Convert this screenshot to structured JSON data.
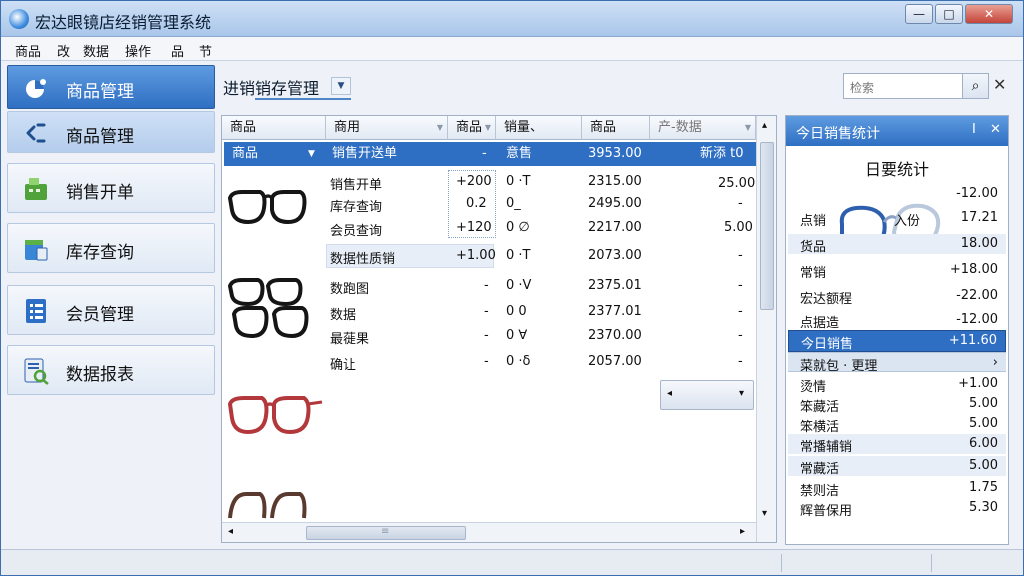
{
  "window": {
    "title": "宏达眼镜店经销管理系统",
    "controls": {
      "minimize": "—",
      "maximize": "□",
      "close": "✕"
    }
  },
  "menubar": {
    "items": [
      "商品",
      "改",
      "数据",
      "操作",
      "品",
      "节"
    ]
  },
  "sidebar": {
    "items": [
      {
        "label": "商品管理",
        "icon": "pie-chart-icon",
        "state": "active"
      },
      {
        "label": "商品管理",
        "icon": "link-icon",
        "state": "highlight"
      },
      {
        "label": "销售开单",
        "icon": "cash-register-icon",
        "state": "normal"
      },
      {
        "label": "库存查询",
        "icon": "inventory-icon",
        "state": "normal"
      },
      {
        "label": "会员管理",
        "icon": "list-icon",
        "state": "normal"
      },
      {
        "label": "数据报表",
        "icon": "report-search-icon",
        "state": "normal"
      }
    ]
  },
  "main": {
    "title": "进销销存管理",
    "title_dropdown": "▼",
    "search": {
      "placeholder": "检索",
      "button": "⌕"
    },
    "close": "✕"
  },
  "grid": {
    "headers": [
      "商品",
      "商用",
      "商品",
      "销量、",
      "商品",
      "产-数据"
    ],
    "selected_row": [
      "商品",
      "销售开送单",
      "-",
      "意售",
      "3953.00",
      "新添 t0"
    ],
    "rows": [
      {
        "name": "销售开单",
        "c2": "+200",
        "c3": "0 ·T",
        "c4": "2315.00",
        "c5": "25.00"
      },
      {
        "name": "库存查询",
        "c2": "0.2",
        "c3": "0_",
        "c4": "2495.00",
        "c5": "-"
      },
      {
        "name": "会员查询",
        "c2": "+120",
        "c3": "0 ∅",
        "c4": "2217.00",
        "c5": "5.00"
      },
      {
        "name": "数据性质销",
        "c2": "+1.00",
        "c3": "0 ·T",
        "c4": "2073.00",
        "c5": "-"
      },
      {
        "name": "数跑图",
        "c2": "-",
        "c3": "0 ·V",
        "c4": "2375.01",
        "c5": "-"
      },
      {
        "name": "数据",
        "c2": "-",
        "c3": "0 0",
        "c4": "2377.01",
        "c5": "-"
      },
      {
        "name": "最蓰果",
        "c2": "-",
        "c3": "0 ∀",
        "c4": "2370.00",
        "c5": "-"
      },
      {
        "name": "确让",
        "c2": "-",
        "c3": "0 ·δ",
        "c4": "2057.00",
        "c5": "-"
      }
    ],
    "nav_left": "◂",
    "nav_right": "▾",
    "hscroll_mark": "≡",
    "scroll_left": "◂",
    "scroll_right": "▸",
    "scroll_up": "▴",
    "scroll_down": "▾"
  },
  "right_panel": {
    "title": "今日销售统计",
    "pin": "I",
    "close": "✕",
    "subtitle": "日要统计",
    "rows": [
      {
        "label": "",
        "value": "-12.00",
        "style": "normal"
      },
      {
        "label": "点销",
        "value": "17.21",
        "style": "normal",
        "mid": "入份"
      },
      {
        "label": "货品",
        "value": "18.00",
        "style": "shade"
      },
      {
        "label": "常销",
        "value": "+18.00",
        "style": "normal"
      },
      {
        "label": "宏达额程",
        "value": "-22.00",
        "style": "normal"
      },
      {
        "label": "点据造",
        "value": "-12.00",
        "style": "normal"
      },
      {
        "label": "今日销售",
        "value": "+11.60",
        "style": "sel"
      },
      {
        "label": "菜就包 · 更理",
        "value": "›",
        "style": "tool"
      },
      {
        "label": "烫情",
        "value": "+1.00",
        "style": "normal"
      },
      {
        "label": "笨藏活",
        "value": "5.00",
        "style": "normal"
      },
      {
        "label": "笨横活",
        "value": "5.00",
        "style": "normal"
      },
      {
        "label": "常播辅销",
        "value": "6.00",
        "style": "shade"
      },
      {
        "label": "常藏活",
        "value": "5.00",
        "style": "shade"
      },
      {
        "label": "禁则洁",
        "value": "1.75",
        "style": "normal"
      },
      {
        "label": "辉普保用",
        "value": "5.30",
        "style": "normal"
      }
    ]
  },
  "colors": {
    "accent": "#2f6fc3",
    "frame_red": "#b3383c",
    "frame_black": "#151515",
    "frame_brown": "#5a3a2e",
    "frame_blue": "#2d5fae"
  }
}
